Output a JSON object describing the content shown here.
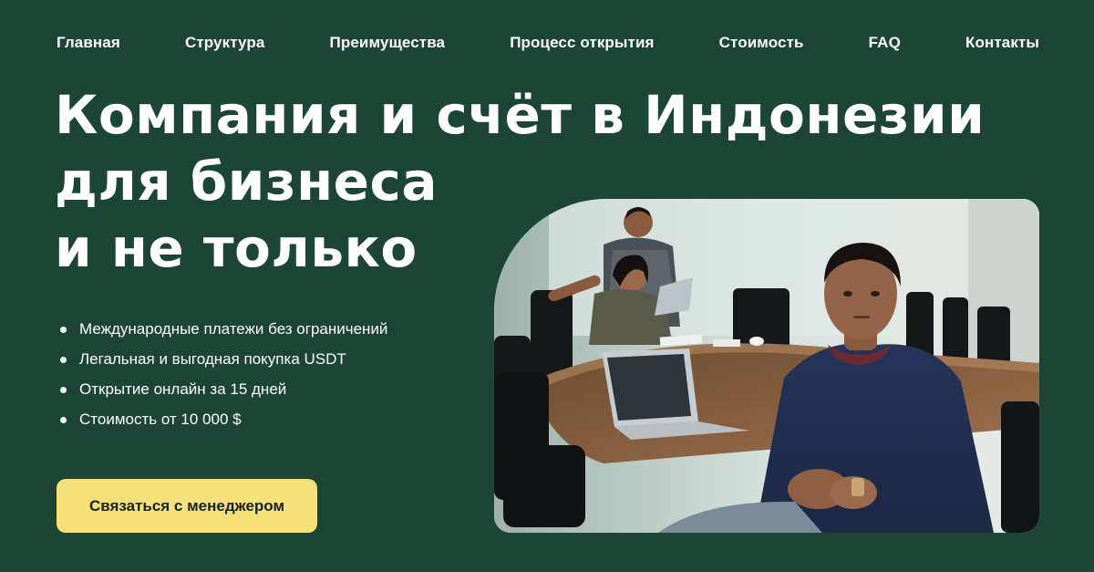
{
  "nav": {
    "items": [
      {
        "label": "Главная"
      },
      {
        "label": "Структура"
      },
      {
        "label": "Преимущества"
      },
      {
        "label": "Процесс открытия"
      },
      {
        "label": "Стоимость"
      },
      {
        "label": "FAQ"
      },
      {
        "label": "Контакты"
      }
    ]
  },
  "hero": {
    "title_lines": [
      "Компания и счёт в Индонезии",
      "для бизнеса",
      "и не только"
    ],
    "features": [
      "Международные платежи без ограничений",
      "Легальная и выгодная покупка USDT",
      "Открытие онлайн за 15 дней",
      "Стоимость от 10 000 $"
    ],
    "cta_label": "Связаться с менеджером"
  },
  "colors": {
    "background": "#1c4536",
    "cta": "#f6e07a",
    "text": "#ffffff"
  }
}
